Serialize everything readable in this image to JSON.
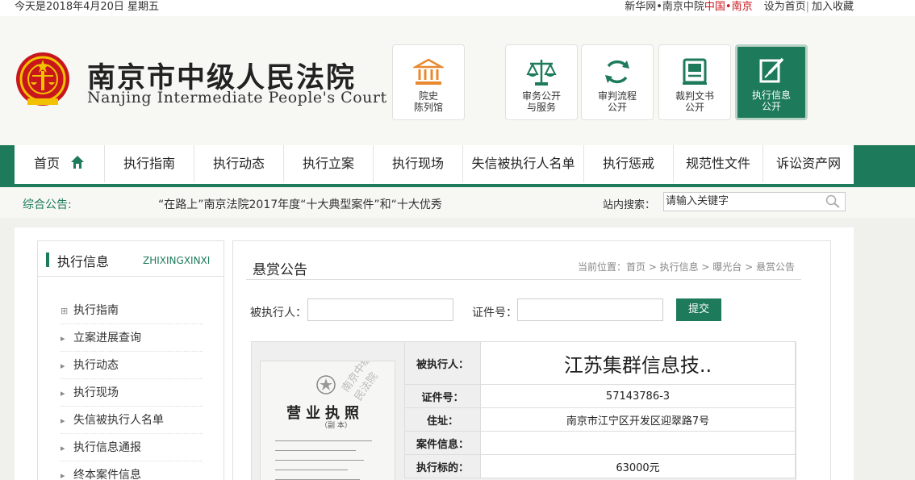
{
  "topbar": {
    "date": "今天是2018年4月20日  星期五",
    "link1": "新华网•南京中院",
    "link2": "中国•南京",
    "link3": "设为首页",
    "link4": "加入收藏"
  },
  "header": {
    "court_cn": "南京市中级人民法院",
    "court_en": "Nanjing Intermediate People's Court",
    "buttons": [
      {
        "line1": "院史",
        "line2": "陈列馆",
        "icon": "museum-icon"
      },
      {
        "line1": "审务公开",
        "line2": "与服务",
        "icon": "scales-icon"
      },
      {
        "line1": "审判流程",
        "line2": "公开",
        "icon": "refresh-cycle-icon"
      },
      {
        "line1": "裁判文书",
        "line2": "公开",
        "icon": "document-icon"
      },
      {
        "line1": "执行信息",
        "line2": "公开",
        "icon": "pen-edit-icon"
      }
    ]
  },
  "nav": [
    "首页",
    "执行指南",
    "执行动态",
    "执行立案",
    "执行现场",
    "失信被执行人名单",
    "执行惩戒",
    "规范性文件",
    "诉讼资产网"
  ],
  "announce": {
    "label": "综合公告:",
    "text": "“在路上”南京法院2017年度“十大典型案件”和“十大优秀",
    "search_label": "站内搜索：",
    "search_placeholder": "请输入关键字"
  },
  "sidebar": {
    "title": "执行信息",
    "title_en": "ZHIXINGXINXI",
    "items": [
      "执行指南",
      "立案进展查询",
      "执行动态",
      "执行现场",
      "失信被执行人名单",
      "执行信息通报",
      "终本案件信息"
    ]
  },
  "main": {
    "title": "悬赏公告",
    "breadcrumb": "当前位置：首页 > 执行信息 > 曝光台 > 悬赏公告",
    "form": {
      "label1": "被执行人：",
      "label2": "证件号：",
      "submit": "提交"
    },
    "photo": {
      "title": "营业执照",
      "sub": "（副 本）",
      "watermark": "南京中级人民法院"
    },
    "record": [
      {
        "key": "被执行人：",
        "value": "江苏集群信息技.."
      },
      {
        "key": "证件号：",
        "value": "57143786-3"
      },
      {
        "key": "住址：",
        "value": "南京市江宁区开发区迎翠路7号"
      },
      {
        "key": "案件信息：",
        "value": ""
      },
      {
        "key": "执行标的：",
        "value": "63000元"
      }
    ]
  },
  "colors": {
    "primary": "#1d7a5a",
    "accent_red": "#c8161d",
    "icon_orange": "#e8892f"
  }
}
